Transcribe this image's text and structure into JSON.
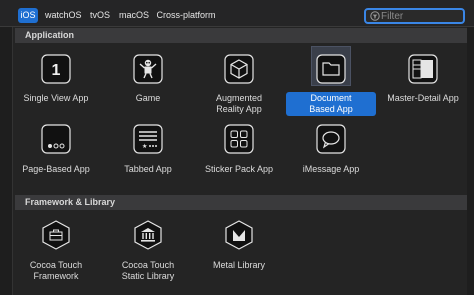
{
  "tabs": [
    "iOS",
    "watchOS",
    "tvOS",
    "macOS",
    "Cross-platform"
  ],
  "selected_tab": "iOS",
  "filter": {
    "placeholder": "Filter",
    "value": ""
  },
  "sections": {
    "application": {
      "title": "Application",
      "templates": [
        {
          "label": "Single View App",
          "icon": "single-view-icon"
        },
        {
          "label": "Game",
          "icon": "game-robot-icon"
        },
        {
          "label": "Augmented\nReality App",
          "icon": "ar-cube-icon"
        },
        {
          "label": "Document\nBased App",
          "icon": "folder-icon",
          "selected": true
        },
        {
          "label": "Master-Detail App",
          "icon": "master-detail-icon"
        },
        {
          "label": "Page-Based App",
          "icon": "page-dots-icon"
        },
        {
          "label": "Tabbed App",
          "icon": "tabbed-icon"
        },
        {
          "label": "Sticker Pack App",
          "icon": "sticker-grid-icon"
        },
        {
          "label": "iMessage App",
          "icon": "message-bubble-icon"
        }
      ]
    },
    "framework": {
      "title": "Framework & Library",
      "templates": [
        {
          "label": "Cocoa Touch\nFramework",
          "icon": "toolbox-icon"
        },
        {
          "label": "Cocoa Touch\nStatic Library",
          "icon": "library-building-icon"
        },
        {
          "label": "Metal Library",
          "icon": "metal-m-icon"
        }
      ]
    }
  },
  "colors": {
    "accent": "#1f6fd1",
    "focus_ring": "#3a86e6"
  }
}
